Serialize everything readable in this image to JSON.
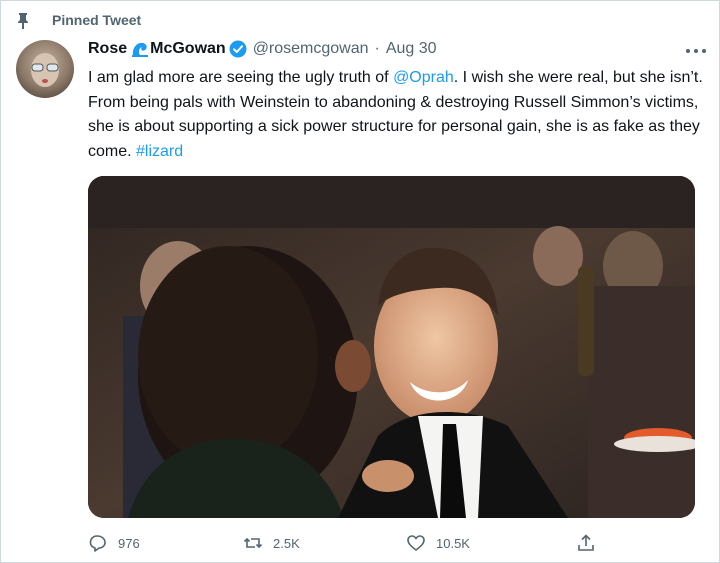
{
  "pinned": {
    "label": "Pinned Tweet",
    "icon": "pin-icon"
  },
  "author": {
    "first_name": "Rose",
    "last_name": "McGowan",
    "handle": "@rosemcgowan",
    "separator": "·",
    "date": "Aug 30",
    "name_emoji": "wave-icon",
    "badge": "verified-icon"
  },
  "tweet": {
    "text_1": "I am glad more are seeing the ugly  truth of ",
    "mention": "@Oprah",
    "text_2": ". I wish she were real, but she isn’t. From being pals with Weinstein to abandoning & destroying Russell Simmon’s victims, she is about supporting a sick power structure for personal gain, she is as fake as they come. ",
    "hashtag": "#lizard"
  },
  "actions": {
    "replies": "976",
    "retweets": "2.5K",
    "likes": "10.5K"
  },
  "colors": {
    "link": "#1d9bf0",
    "secondary_text": "#536471",
    "verified": "#1d9bf0"
  }
}
